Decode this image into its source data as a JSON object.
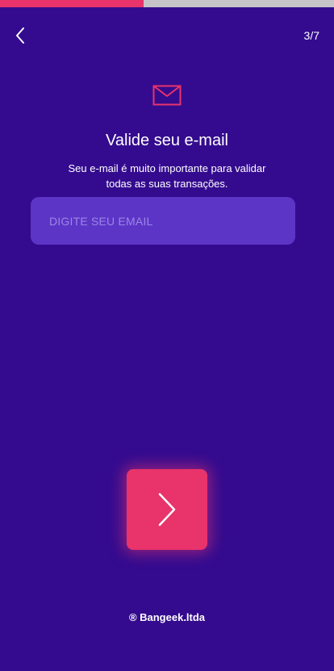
{
  "progress": {
    "current_step": 3,
    "total_steps": 7,
    "fraction": 0.43,
    "fill_color": "#e8336b",
    "track_color": "#c6c4c9"
  },
  "header": {
    "step_label": "3/7",
    "back_icon": "chevron-left-icon"
  },
  "content": {
    "icon": "envelope-icon",
    "title": "Valide seu e-mail",
    "subtitle": "Seu e-mail é muito importante para validar todas as suas transações."
  },
  "email_input": {
    "placeholder": "DIGITE SEU EMAIL",
    "value": ""
  },
  "next_button": {
    "icon": "chevron-right-icon"
  },
  "footer": {
    "brand": "® Bangeek.ltda"
  },
  "colors": {
    "background": "#340b8f",
    "accent": "#e8336b",
    "input_bg": "#5c35c6"
  }
}
